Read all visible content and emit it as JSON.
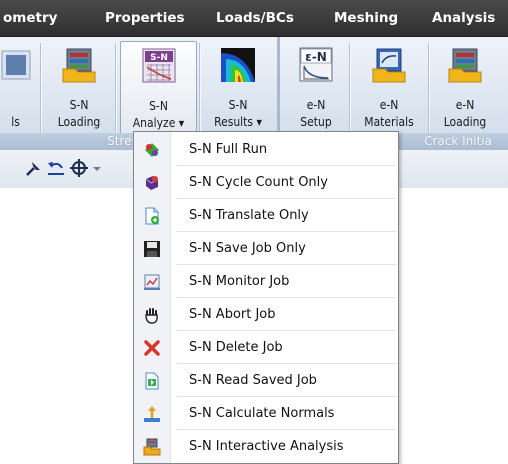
{
  "tabs": [
    "ometry",
    "Properties",
    "Loads/BCs",
    "Meshing",
    "Analysis"
  ],
  "ribbon": {
    "buttons": [
      {
        "line1": "",
        "line2": "ls",
        "icon": "stress-life-icon"
      },
      {
        "line1": "S-N",
        "line2": "Loading",
        "icon": "sn-loading-icon"
      },
      {
        "line1": "S-N",
        "line2": "Analyze ▾",
        "icon": "sn-analyze-icon",
        "badge": "S-N"
      },
      {
        "line1": "S-N",
        "line2": "Results ▾",
        "icon": "sn-results-icon"
      },
      {
        "line1": "e-N",
        "line2": "Setup",
        "icon": "en-setup-icon",
        "badge": "ε-N"
      },
      {
        "line1": "e-N",
        "line2": "Materials",
        "icon": "en-materials-icon"
      },
      {
        "line1": "e-N",
        "line2": "Loading",
        "icon": "en-loading-icon"
      }
    ],
    "groups": [
      "Stress-Life",
      "Crack Initia"
    ]
  },
  "menu": {
    "items": [
      {
        "label": "S-N Full Run",
        "icon": "full-run-icon"
      },
      {
        "label": "S-N Cycle Count Only",
        "icon": "cycle-count-icon"
      },
      {
        "label": "S-N Translate Only",
        "icon": "translate-icon"
      },
      {
        "label": "S-N Save Job Only",
        "icon": "save-icon"
      },
      {
        "label": "S-N Monitor Job",
        "icon": "monitor-icon"
      },
      {
        "label": "S-N Abort Job",
        "icon": "hand-icon"
      },
      {
        "label": "S-N Delete Job",
        "icon": "delete-icon"
      },
      {
        "label": "S-N Read Saved Job",
        "icon": "read-job-icon"
      },
      {
        "label": "S-N Calculate Normals",
        "icon": "normals-icon"
      },
      {
        "label": "S-N Interactive Analysis",
        "icon": "interactive-icon"
      }
    ]
  },
  "colors": {
    "tabbar": "#3c3c3c",
    "ribbon": "#dde6f1",
    "group_label": "#b4c4d8",
    "menu_gutter": "#f0f2f5"
  }
}
